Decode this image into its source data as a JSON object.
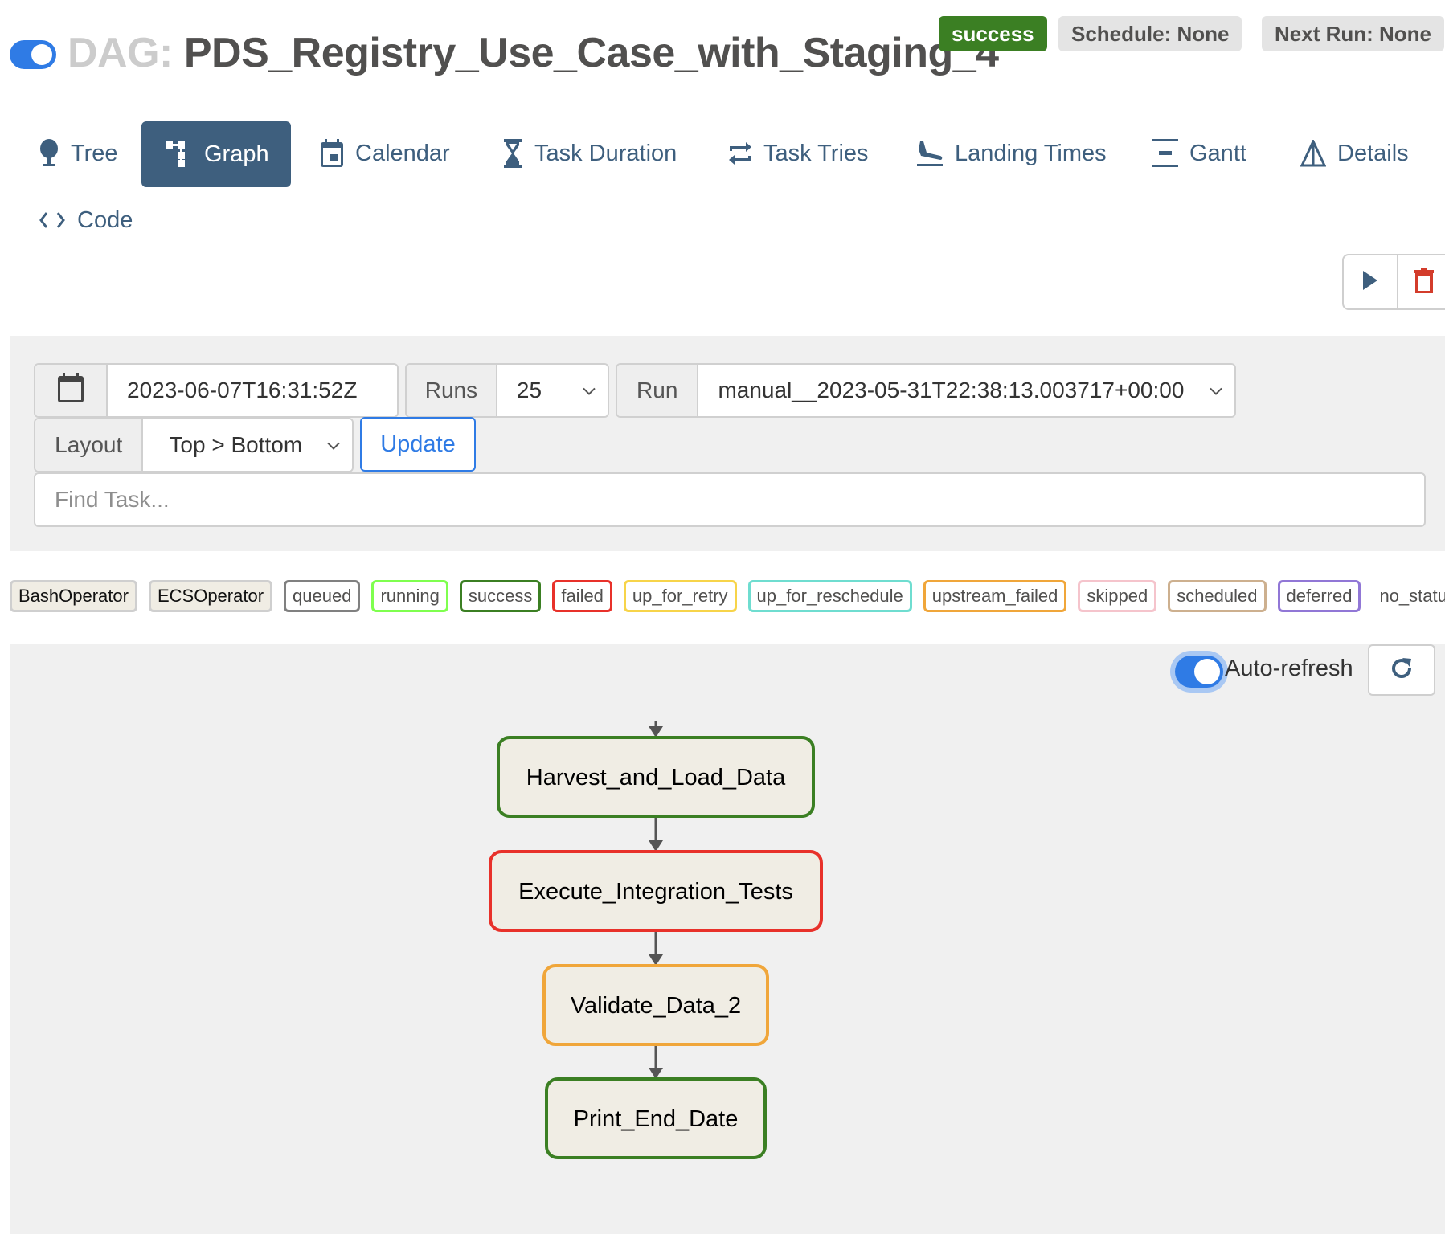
{
  "header": {
    "dag_prefix": "DAG:",
    "dag_name": "PDS_Registry_Use_Case_with_Staging_4",
    "dag_paused": false,
    "status_badge": "success",
    "schedule_badge": "Schedule: None",
    "next_run_badge": "Next Run: None"
  },
  "nav": {
    "tabs": [
      {
        "label": "Tree",
        "icon": "tree-icon",
        "active": false
      },
      {
        "label": "Graph",
        "icon": "graph-icon",
        "active": true
      },
      {
        "label": "Calendar",
        "icon": "calendar-icon",
        "active": false
      },
      {
        "label": "Task Duration",
        "icon": "hourglass-icon",
        "active": false
      },
      {
        "label": "Task Tries",
        "icon": "retry-arrows-icon",
        "active": false
      },
      {
        "label": "Landing Times",
        "icon": "plane-landing-icon",
        "active": false
      },
      {
        "label": "Gantt",
        "icon": "gantt-icon",
        "active": false
      },
      {
        "label": "Details",
        "icon": "triangle-icon",
        "active": false
      },
      {
        "label": "Code",
        "icon": "code-icon",
        "active": false
      }
    ]
  },
  "actions": {
    "trigger": "play-icon",
    "delete": "trash-icon"
  },
  "filters": {
    "base_date": "2023-06-07T16:31:52Z",
    "runs_label": "Runs",
    "runs_value": "25",
    "run_label": "Run",
    "run_value": "manual__2023-05-31T22:38:13.003717+00:00",
    "layout_label": "Layout",
    "layout_value": "Top > Bottom",
    "update_label": "Update",
    "find_task_placeholder": "Find Task..."
  },
  "legend": {
    "operators": [
      {
        "label": "BashOperator"
      },
      {
        "label": "ECSOperator"
      }
    ],
    "states": [
      {
        "label": "queued",
        "color": "#808080"
      },
      {
        "label": "running",
        "color": "#7fff4f"
      },
      {
        "label": "success",
        "color": "#3b7f23"
      },
      {
        "label": "failed",
        "color": "#e8312a"
      },
      {
        "label": "up_for_retry",
        "color": "#f7d44a"
      },
      {
        "label": "up_for_reschedule",
        "color": "#6fddd0"
      },
      {
        "label": "upstream_failed",
        "color": "#f0a63a"
      },
      {
        "label": "skipped",
        "color": "#f5c4cc"
      },
      {
        "label": "scheduled",
        "color": "#cdb08f"
      },
      {
        "label": "deferred",
        "color": "#9177d6"
      },
      {
        "label": "no_status",
        "color": null
      }
    ]
  },
  "graph": {
    "auto_refresh_label": "Auto-refresh",
    "auto_refresh_on": true,
    "nodes": [
      {
        "id": "Harvest_and_Load_Data",
        "label": "Harvest_and_Load_Data",
        "state": "success",
        "color": "#3b7f23"
      },
      {
        "id": "Execute_Integration_Tests",
        "label": "Execute_Integration_Tests",
        "state": "failed",
        "color": "#e8312a"
      },
      {
        "id": "Validate_Data_2",
        "label": "Validate_Data_2",
        "state": "upstream_failed",
        "color": "#f0a63a"
      },
      {
        "id": "Print_End_Date",
        "label": "Print_End_Date",
        "state": "success",
        "color": "#3b7f23"
      }
    ],
    "edges": [
      {
        "from": null,
        "to": "Harvest_and_Load_Data"
      },
      {
        "from": "Harvest_and_Load_Data",
        "to": "Execute_Integration_Tests"
      },
      {
        "from": "Execute_Integration_Tests",
        "to": "Validate_Data_2"
      },
      {
        "from": "Validate_Data_2",
        "to": "Print_End_Date"
      }
    ]
  }
}
